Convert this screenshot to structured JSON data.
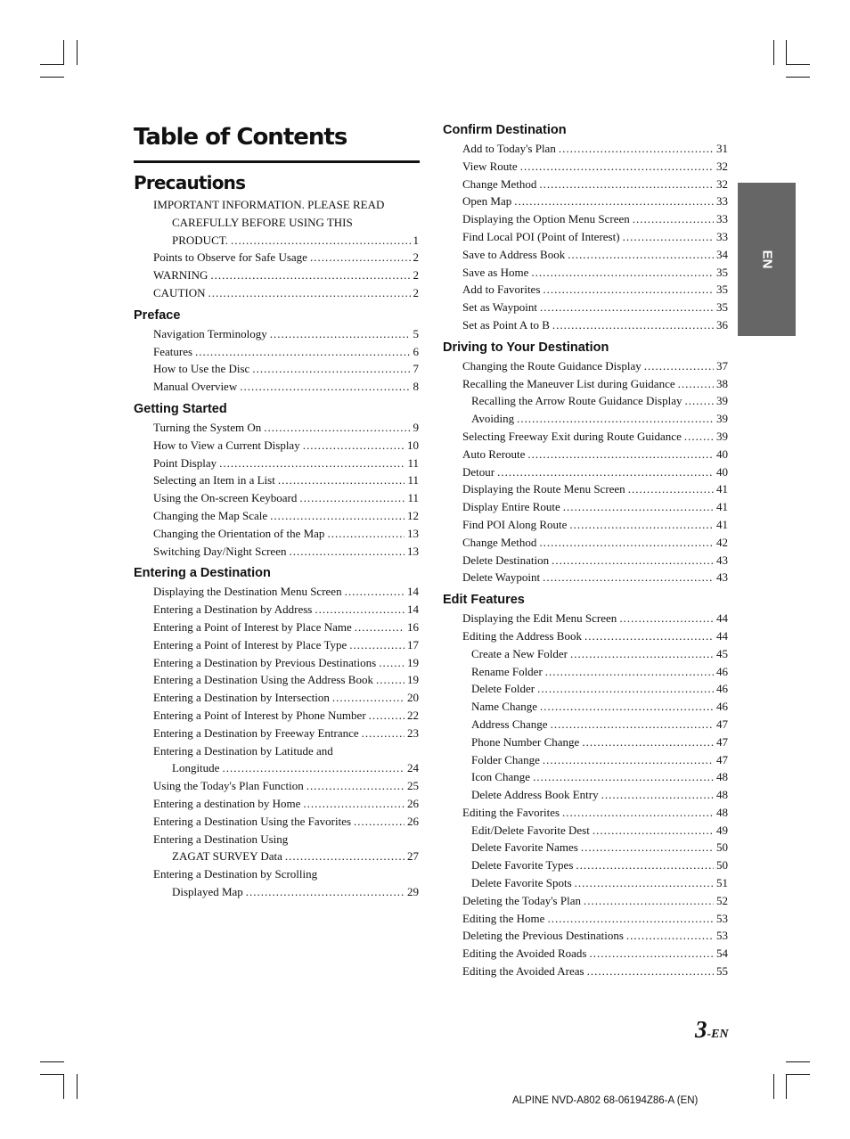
{
  "title": "Table of Contents",
  "side_tab": "EN",
  "page_number": {
    "number": "3",
    "suffix": "-EN"
  },
  "footer": "ALPINE NVD-A802 68-06194Z86-A (EN)",
  "left_column": {
    "major_heading": "Precautions",
    "precautions": {
      "important_line1": "IMPORTANT INFORMATION. PLEASE READ",
      "important_line2": "CAREFULLY BEFORE USING THIS",
      "important_line3": "PRODUCT.",
      "important_page": "1",
      "items": [
        {
          "text": "Points to Observe for Safe Usage",
          "page": "2"
        },
        {
          "text": "WARNING",
          "page": "2"
        },
        {
          "text": "CAUTION",
          "page": "2"
        }
      ]
    },
    "preface": {
      "heading": "Preface",
      "items": [
        {
          "text": "Navigation Terminology",
          "page": "5"
        },
        {
          "text": "Features",
          "page": "6"
        },
        {
          "text": "How to Use the Disc",
          "page": "7"
        },
        {
          "text": "Manual Overview",
          "page": "8"
        }
      ]
    },
    "getting_started": {
      "heading": "Getting Started",
      "items": [
        {
          "text": "Turning the System On",
          "page": "9"
        },
        {
          "text": "How to View a Current Display",
          "page": "10"
        },
        {
          "text": "Point Display",
          "page": "11"
        },
        {
          "text": "Selecting an Item in a List",
          "page": "11"
        },
        {
          "text": "Using the On-screen Keyboard",
          "page": "11"
        },
        {
          "text": "Changing the Map Scale",
          "page": "12"
        },
        {
          "text": "Changing the Orientation of the Map",
          "page": "13"
        },
        {
          "text": "Switching Day/Night Screen",
          "page": "13"
        }
      ]
    },
    "entering": {
      "heading": "Entering a Destination",
      "items": [
        {
          "text": "Displaying the Destination Menu Screen",
          "page": "14"
        },
        {
          "text": "Entering a Destination by Address",
          "page": "14"
        },
        {
          "text": "Entering a Point of Interest by Place Name",
          "page": "16"
        },
        {
          "text": "Entering a Point of Interest by Place Type",
          "page": "17"
        },
        {
          "text": "Entering a Destination by Previous Destinations",
          "page": "19"
        },
        {
          "text": "Entering a Destination Using the Address Book",
          "page": "19"
        },
        {
          "text": "Entering a Destination by Intersection",
          "page": "20"
        },
        {
          "text": "Entering a Point of Interest by Phone Number",
          "page": "22"
        },
        {
          "text": "Entering a Destination by Freeway Entrance",
          "page": "23"
        }
      ],
      "latlong_line1": "Entering a Destination by Latitude and",
      "latlong_line2": "Longitude",
      "latlong_page": "24",
      "items2": [
        {
          "text": "Using the Today's Plan Function",
          "page": "25"
        },
        {
          "text": "Entering a destination by Home",
          "page": "26"
        },
        {
          "text": "Entering a Destination Using the Favorites",
          "page": "26"
        }
      ],
      "zagat_line1": "Entering a Destination Using",
      "zagat_line2": "ZAGAT SURVEY Data",
      "zagat_page": "27",
      "scroll_line1": "Entering a Destination by Scrolling",
      "scroll_line2": "Displayed Map",
      "scroll_page": "29"
    }
  },
  "right_column": {
    "confirm": {
      "heading": "Confirm Destination",
      "items": [
        {
          "text": "Add to Today's Plan",
          "page": "31"
        },
        {
          "text": "View Route",
          "page": "32"
        },
        {
          "text": "Change Method",
          "page": "32"
        },
        {
          "text": "Open Map",
          "page": "33"
        },
        {
          "text": "Displaying the Option Menu Screen",
          "page": "33"
        },
        {
          "text": "Find Local POI (Point of Interest)",
          "page": "33"
        },
        {
          "text": "Save to Address Book",
          "page": "34"
        },
        {
          "text": "Save as Home",
          "page": "35"
        },
        {
          "text": "Add to Favorites",
          "page": "35"
        },
        {
          "text": "Set as Waypoint",
          "page": "35"
        },
        {
          "text": "Set as Point A to B",
          "page": "36"
        }
      ]
    },
    "driving": {
      "heading": "Driving to Your Destination",
      "items": [
        {
          "text": "Changing the Route Guidance Display",
          "page": "37",
          "level": 1
        },
        {
          "text": "Recalling the Maneuver List during Guidance",
          "page": "38",
          "level": 1
        },
        {
          "text": "Recalling the Arrow Route Guidance Display",
          "page": "39",
          "level": 2
        },
        {
          "text": "Avoiding",
          "page": "39",
          "level": 2
        },
        {
          "text": "Selecting Freeway Exit during Route Guidance",
          "page": "39",
          "level": 1
        },
        {
          "text": "Auto Reroute",
          "page": "40",
          "level": 1
        },
        {
          "text": "Detour",
          "page": "40",
          "level": 1
        },
        {
          "text": "Displaying the Route Menu Screen",
          "page": "41",
          "level": 1
        },
        {
          "text": "Display Entire Route",
          "page": "41",
          "level": 1
        },
        {
          "text": "Find POI Along Route",
          "page": "41",
          "level": 1
        },
        {
          "text": "Change Method",
          "page": "42",
          "level": 1
        },
        {
          "text": "Delete Destination",
          "page": "43",
          "level": 1
        },
        {
          "text": "Delete Waypoint",
          "page": "43",
          "level": 1
        }
      ]
    },
    "edit": {
      "heading": "Edit Features",
      "items": [
        {
          "text": "Displaying the Edit Menu Screen",
          "page": "44",
          "level": 1
        },
        {
          "text": "Editing the Address Book",
          "page": "44",
          "level": 1
        },
        {
          "text": "Create a New Folder",
          "page": "45",
          "level": 2
        },
        {
          "text": "Rename Folder",
          "page": "46",
          "level": 2
        },
        {
          "text": "Delete Folder",
          "page": "46",
          "level": 2
        },
        {
          "text": "Name Change",
          "page": "46",
          "level": 2
        },
        {
          "text": "Address Change",
          "page": "47",
          "level": 2
        },
        {
          "text": "Phone Number Change",
          "page": "47",
          "level": 2
        },
        {
          "text": "Folder Change",
          "page": "47",
          "level": 2
        },
        {
          "text": "Icon Change",
          "page": "48",
          "level": 2
        },
        {
          "text": "Delete Address Book Entry",
          "page": "48",
          "level": 2
        },
        {
          "text": "Editing the Favorites",
          "page": "48",
          "level": 1
        },
        {
          "text": "Edit/Delete Favorite Dest",
          "page": "49",
          "level": 2
        },
        {
          "text": "Delete Favorite Names",
          "page": "50",
          "level": 2
        },
        {
          "text": "Delete Favorite Types",
          "page": "50",
          "level": 2
        },
        {
          "text": "Delete Favorite Spots",
          "page": "51",
          "level": 2
        },
        {
          "text": "Deleting the Today's Plan",
          "page": "52",
          "level": 1
        },
        {
          "text": "Editing the Home",
          "page": "53",
          "level": 1
        },
        {
          "text": "Deleting the Previous Destinations",
          "page": "53",
          "level": 1
        },
        {
          "text": "Editing the Avoided Roads",
          "page": "54",
          "level": 1
        },
        {
          "text": "Editing the Avoided Areas",
          "page": "55",
          "level": 1
        }
      ]
    }
  }
}
